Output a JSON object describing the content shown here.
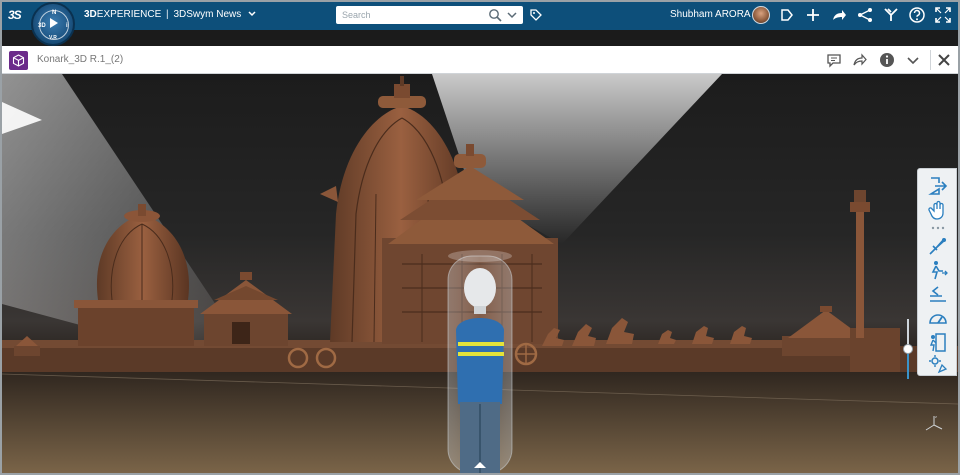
{
  "topbar": {
    "logo_text": "3S",
    "compass": {
      "left_label": "3D",
      "top_label": "N",
      "right_label": "i",
      "version": "V.R"
    },
    "brand_prefix": "3D",
    "brand_name": "EXPERIENCE",
    "brand_separator": "|",
    "app_name": "3DSwym News",
    "search_placeholder": "Search",
    "search_value": "",
    "user_name": "Shubham ARORA",
    "icons": [
      "tag-icon",
      "avatar",
      "tags-icon",
      "plus-icon",
      "share-icon",
      "network-icon",
      "apps-icon",
      "help-icon",
      "fullscreen-icon"
    ]
  },
  "widget": {
    "title": "Konark_3D R.1_(2)",
    "icons": [
      "comment-icon",
      "share-icon",
      "info-icon",
      "chevron-down-icon",
      "close-icon"
    ]
  },
  "viewport": {
    "toolbar_icons": [
      "exit-icon",
      "hand-icon",
      "more-dots-icon",
      "fly-icon",
      "walk-icon",
      "level-icon",
      "speed-icon",
      "door-icon",
      "settings-icon"
    ],
    "slider_level": 0.5
  },
  "colors": {
    "topbar": "#0d4f7a",
    "app_icon": "#6b2a8a",
    "accent": "#3a93c9",
    "temple": "#7a4a30",
    "avatar_shirt": "#2f6fb0",
    "avatar_stripe": "#e3e23a"
  }
}
